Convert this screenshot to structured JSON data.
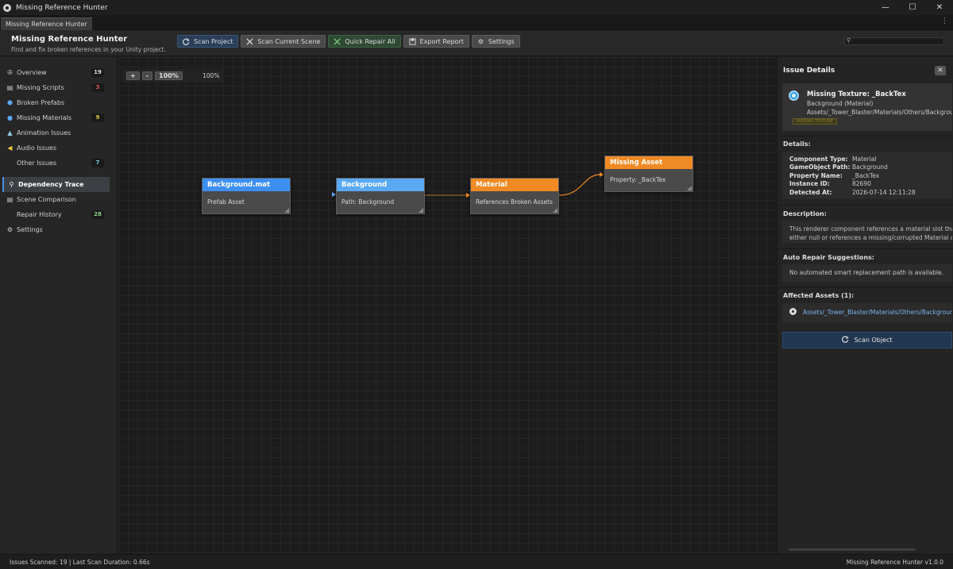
{
  "window": {
    "title": "Missing Reference Hunter",
    "controls": [
      "—",
      "☐",
      "✕"
    ]
  },
  "tab": {
    "label": "Missing Reference Hunter",
    "more": "⋮"
  },
  "header": {
    "title": "Missing Reference Hunter",
    "subtitle": "Find and fix broken references in your Unity project."
  },
  "toolbar": {
    "scan_project": "Scan Project",
    "scan_scene": "Scan Current Scene",
    "quick_repair": "Quick Repair All",
    "export_report": "Export Report",
    "settings": "Settings",
    "search_placeholder": ""
  },
  "sidebar": {
    "items": [
      {
        "label": "Overview",
        "icon": "dashboard-icon",
        "count": "19",
        "count_color": "#e0e0e0"
      },
      {
        "label": "Missing Scripts",
        "icon": "script-icon",
        "count": "3",
        "count_color": "#e05a5a"
      },
      {
        "label": "Broken Prefabs",
        "icon": "prefab-icon",
        "count": "",
        "count_color": ""
      },
      {
        "label": "Missing Materials",
        "icon": "material-icon",
        "count": "9",
        "count_color": "#e0c84a"
      },
      {
        "label": "Animation Issues",
        "icon": "animation-icon",
        "count": "",
        "count_color": ""
      },
      {
        "label": "Audio Issues",
        "icon": "audio-icon",
        "count": "",
        "count_color": ""
      },
      {
        "label": "Other Issues",
        "icon": "",
        "count": "7",
        "count_color": "#7ad0e0"
      },
      {
        "label": "Dependency Trace",
        "icon": "trace-icon",
        "count": "",
        "count_color": "",
        "active": true
      },
      {
        "label": "Scene Comparison",
        "icon": "compare-icon",
        "count": "",
        "count_color": ""
      },
      {
        "label": "Repair History",
        "icon": "",
        "count": "28",
        "count_color": "#8ad08a"
      },
      {
        "label": "Settings",
        "icon": "gear-icon",
        "count": "",
        "count_color": ""
      }
    ]
  },
  "graph": {
    "zoom_in": "+",
    "zoom_out": "-",
    "zoom_reset": "100%",
    "zoom_level": "100%",
    "nodes": [
      {
        "title": "Background.mat",
        "body": "Prefab Asset",
        "color": "#3d8ff0"
      },
      {
        "title": "Background",
        "body": "Path: Background",
        "color": "#5aa9f2"
      },
      {
        "title": "Material",
        "body": "References Broken Assets",
        "color": "#ef8a24"
      },
      {
        "title": "Missing Asset",
        "body": "Property: _BackTex",
        "color": "#ef8a24"
      }
    ]
  },
  "details": {
    "title": "Issue Details",
    "close": "✕",
    "issue": {
      "title": "Missing Texture: _BackTex",
      "object": "Background (Material)",
      "path": "Assets/_Tower_Blaster/Materials/Others/Background.mat",
      "badge": "MISSING TEXTURE"
    },
    "details_label": "Details:",
    "fields": [
      {
        "key": "Component Type:",
        "value": "Material"
      },
      {
        "key": "GameObject Path:",
        "value": "Background"
      },
      {
        "key": "Property Name:",
        "value": "_BackTex"
      },
      {
        "key": "Instance ID:",
        "value": "82690"
      },
      {
        "key": "Detected At:",
        "value": "2026-07-14 12:11:28"
      }
    ],
    "description_label": "Description:",
    "description_line1": "This renderer component references a material slot that is",
    "description_line2": "either null or references a missing/corrupted Material asset.",
    "repair_label": "Auto Repair Suggestions:",
    "repair_text": "No automated smart replacement path is available.",
    "affected_label": "Affected Assets (1):",
    "affected_asset": "Assets/_Tower_Blaster/Materials/Others/Background.mat",
    "scan_object": "Scan Object"
  },
  "status": {
    "left": "Issues Scanned: 19 | Last Scan Duration: 0.66s",
    "right": "Missing Reference Hunter v1.0.0"
  }
}
